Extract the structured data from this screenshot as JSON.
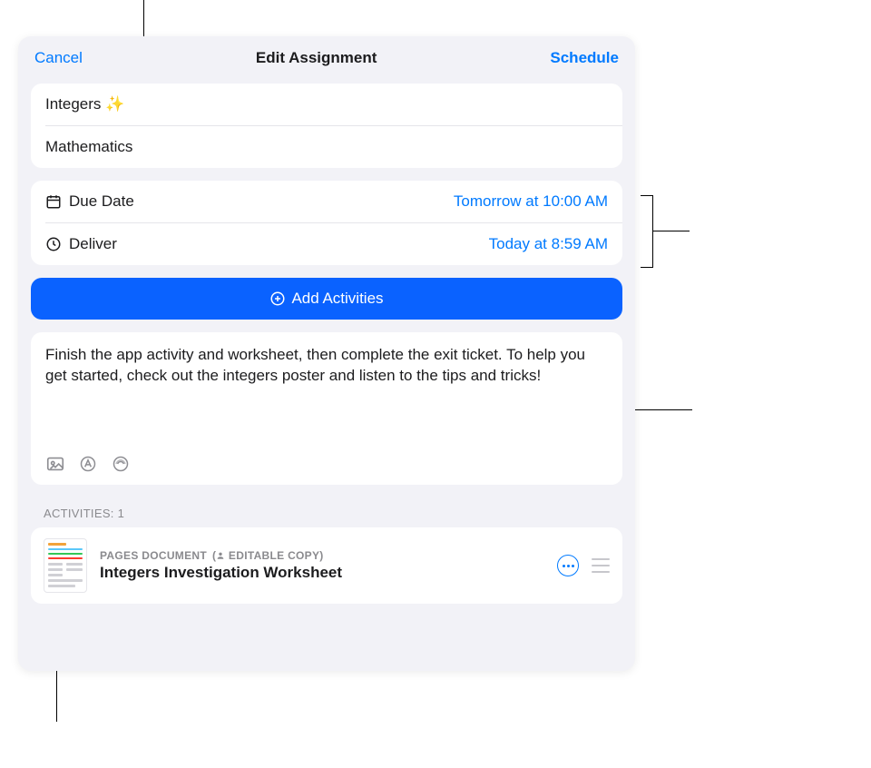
{
  "nav": {
    "cancel": "Cancel",
    "title": "Edit Assignment",
    "action": "Schedule"
  },
  "assignment": {
    "title": "Integers ✨",
    "class": "Mathematics"
  },
  "schedule": {
    "due_label": "Due Date",
    "due_value": "Tomorrow at 10:00 AM",
    "deliver_label": "Deliver",
    "deliver_value": "Today at 8:59 AM"
  },
  "add_button": "Add Activities",
  "instructions": "Finish the app activity and worksheet, then complete the exit ticket. To help you get started, check out the integers poster and listen to the tips and tricks!",
  "activities_header": "ACTIVITIES: 1",
  "activity": {
    "type": "PAGES DOCUMENT",
    "badge": "EDITABLE COPY",
    "title": "Integers Investigation Worksheet"
  }
}
